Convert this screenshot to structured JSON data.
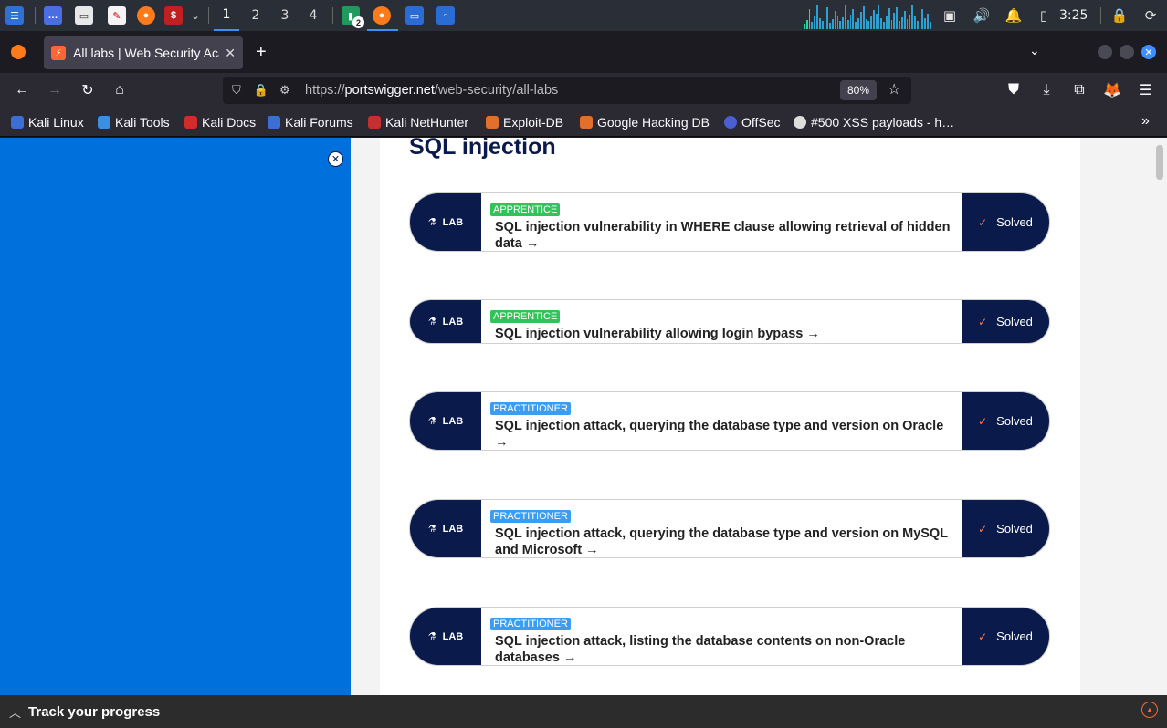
{
  "taskbar": {
    "workspaces": [
      "1",
      "2",
      "3",
      "4"
    ],
    "active_workspace": "1",
    "badge": "2",
    "clock": "3:25"
  },
  "browser": {
    "tab_title": "All labs | Web Security Acade",
    "url_scheme": "https://",
    "url_host": "portswigger.net",
    "url_path": "/web-security/all-labs",
    "zoom": "80%"
  },
  "bookmarks": [
    {
      "label": "Kali Linux",
      "color": "#3b6fd4"
    },
    {
      "label": "Kali Tools",
      "color": "#3b8fe0"
    },
    {
      "label": "Kali Docs",
      "color": "#d22b2b"
    },
    {
      "label": "Kali Forums",
      "color": "#3b6fd4"
    },
    {
      "label": "Kali NetHunter",
      "color": "#c23030"
    },
    {
      "label": "Exploit-DB",
      "color": "#e0702b"
    },
    {
      "label": "Google Hacking DB",
      "color": "#e0702b"
    },
    {
      "label": "OffSec",
      "color": "#4a5fd0"
    },
    {
      "label": "#500 XSS payloads - h…",
      "color": "#dddddd"
    }
  ],
  "page": {
    "section_title": "SQL injection",
    "lab_tag": "LAB",
    "status_label": "Solved",
    "labs": [
      {
        "level": "APPRENTICE",
        "title": "SQL injection vulnerability in WHERE clause allowing retrieval of hidden data →",
        "status": "Solved"
      },
      {
        "level": "APPRENTICE",
        "title": "SQL injection vulnerability allowing login bypass →",
        "status": "Solved"
      },
      {
        "level": "PRACTITIONER",
        "title": "SQL injection attack, querying the database type and version on Oracle →",
        "status": "Solved"
      },
      {
        "level": "PRACTITIONER",
        "title": "SQL injection attack, querying the database type and version on MySQL and Microsoft →",
        "status": "Solved"
      },
      {
        "level": "PRACTITIONER",
        "title": "SQL injection attack, listing the database contents on non-Oracle databases →",
        "status": "Solved"
      }
    ]
  },
  "progress_bar": {
    "label": "Track your progress"
  }
}
